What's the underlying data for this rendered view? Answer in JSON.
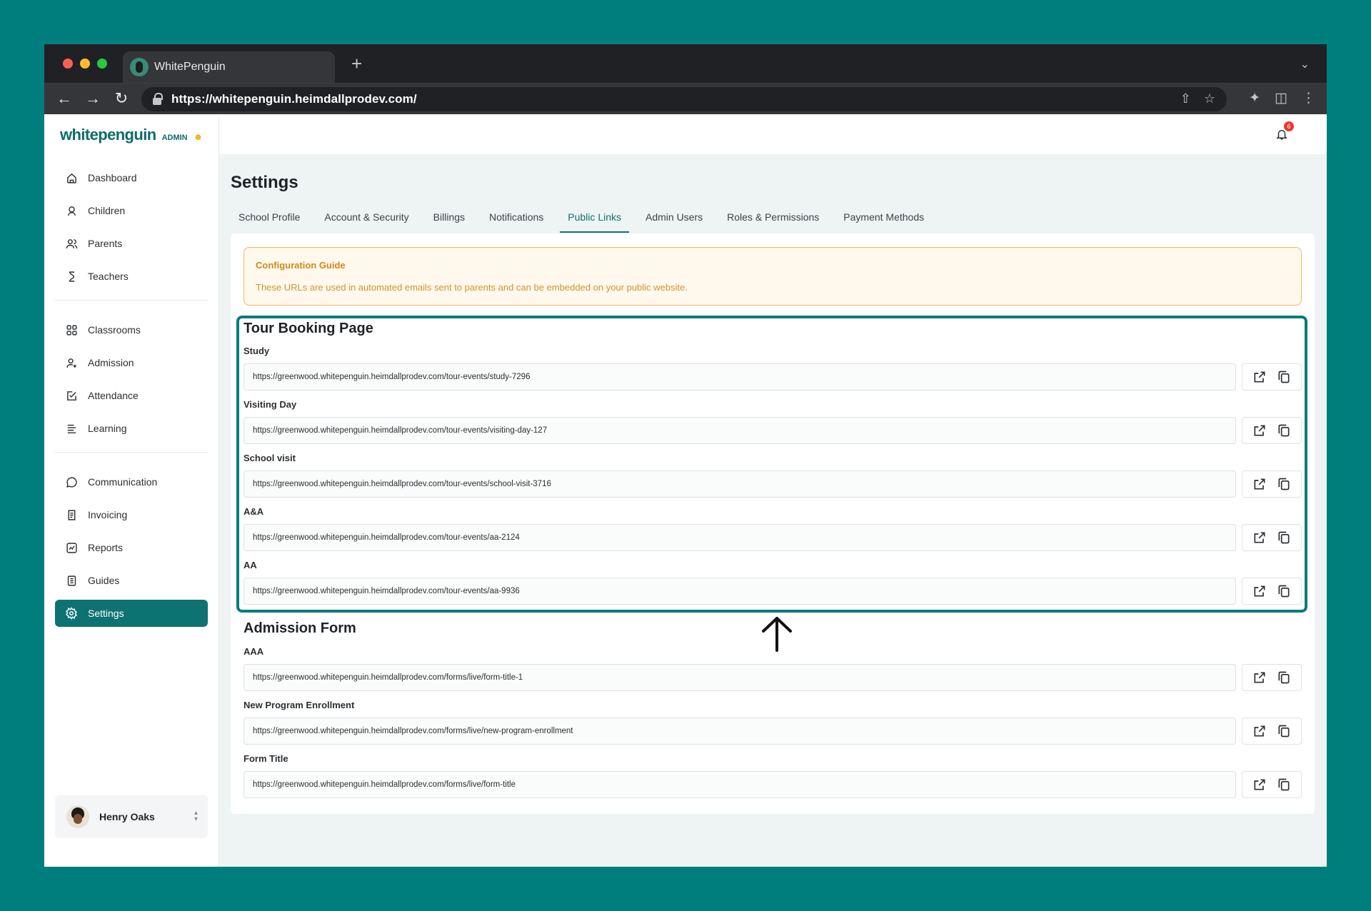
{
  "browser": {
    "tab_title": "WhitePenguin",
    "url": "https://whitepenguin.heimdallprodev.com/"
  },
  "sidebar": {
    "logo": "whitepenguin",
    "logo_badge": "ADMIN",
    "groups": [
      [
        {
          "label": "Dashboard",
          "icon": "home-icon"
        },
        {
          "label": "Children",
          "icon": "child-icon"
        },
        {
          "label": "Parents",
          "icon": "users-icon"
        },
        {
          "label": "Teachers",
          "icon": "teacher-icon"
        }
      ],
      [
        {
          "label": "Classrooms",
          "icon": "grid-icon"
        },
        {
          "label": "Admission",
          "icon": "user-add-icon"
        },
        {
          "label": "Attendance",
          "icon": "check-icon"
        },
        {
          "label": "Learning",
          "icon": "learning-icon"
        }
      ],
      [
        {
          "label": "Communication",
          "icon": "chat-icon"
        },
        {
          "label": "Invoicing",
          "icon": "invoice-icon"
        },
        {
          "label": "Reports",
          "icon": "chart-icon"
        },
        {
          "label": "Guides",
          "icon": "book-icon"
        },
        {
          "label": "Settings",
          "icon": "gear-icon",
          "active": true
        }
      ]
    ],
    "user_name": "Henry Oaks"
  },
  "header": {
    "notification_count": "6"
  },
  "page": {
    "title": "Settings",
    "tabs": [
      "School Profile",
      "Account & Security",
      "Billings",
      "Notifications",
      "Public Links",
      "Admin Users",
      "Roles & Permissions",
      "Payment Methods"
    ],
    "active_tab": "Public Links"
  },
  "guide": {
    "title": "Configuration Guide",
    "text": "These URLs are used in automated emails sent to parents and can be embedded on your public website."
  },
  "sections": [
    {
      "title": "Tour Booking Page",
      "links": [
        {
          "label": "Study",
          "url": "https://greenwood.whitepenguin.heimdallprodev.com/tour-events/study-7296"
        },
        {
          "label": "Visiting Day",
          "url": "https://greenwood.whitepenguin.heimdallprodev.com/tour-events/visiting-day-127"
        },
        {
          "label": "School visit",
          "url": "https://greenwood.whitepenguin.heimdallprodev.com/tour-events/school-visit-3716"
        },
        {
          "label": "A&A",
          "url": "https://greenwood.whitepenguin.heimdallprodev.com/tour-events/aa-2124"
        },
        {
          "label": "AA",
          "url": "https://greenwood.whitepenguin.heimdallprodev.com/tour-events/aa-9936"
        }
      ]
    },
    {
      "title": "Admission Form",
      "links": [
        {
          "label": "AAA",
          "url": "https://greenwood.whitepenguin.heimdallprodev.com/forms/live/form-title-1"
        },
        {
          "label": "New Program Enrollment",
          "url": "https://greenwood.whitepenguin.heimdallprodev.com/forms/live/new-program-enrollment"
        },
        {
          "label": "Form Title",
          "url": "https://greenwood.whitepenguin.heimdallprodev.com/forms/live/form-title"
        }
      ]
    }
  ]
}
